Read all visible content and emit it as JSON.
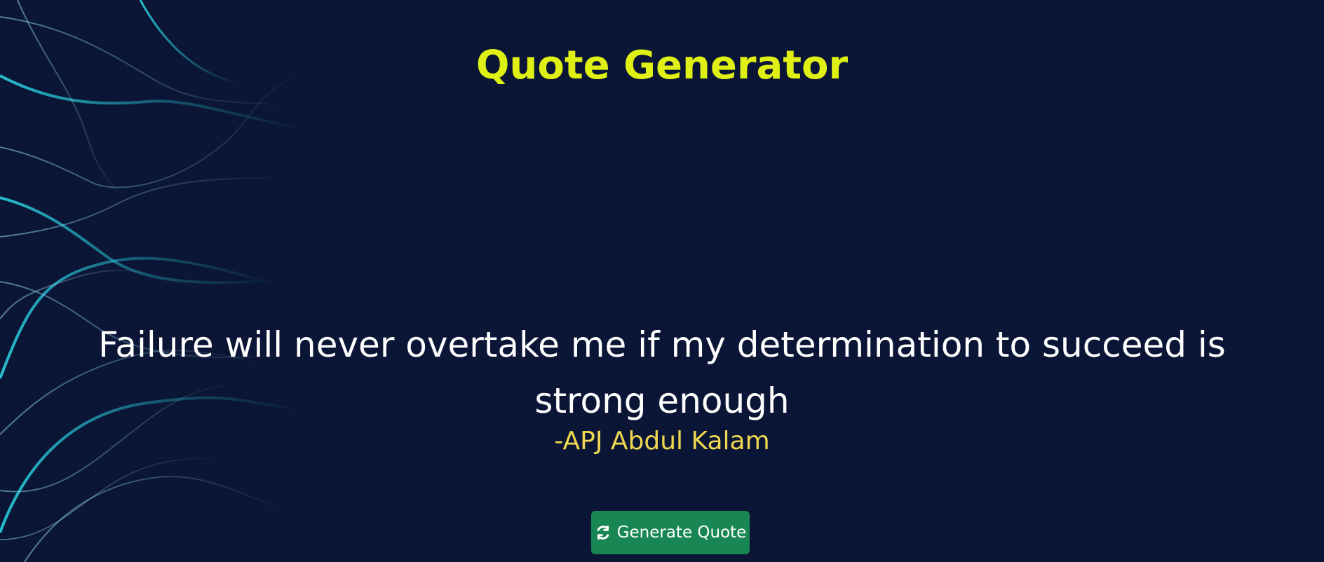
{
  "app": {
    "title": "Quote Generator",
    "background_color": "#0b1535"
  },
  "quote": {
    "text": "Failure will never overtake me if my determination to succeed is strong enough",
    "author": "-APJ Abdul Kalam",
    "author_color": "#f1d851"
  },
  "actions": {
    "generate_label": "Generate Quote",
    "generate_icon": "refresh-icon",
    "generate_color": "#198754"
  },
  "colors": {
    "title": "#dff015",
    "text": "#ffffff",
    "accent_lines": "#28c7d6"
  }
}
